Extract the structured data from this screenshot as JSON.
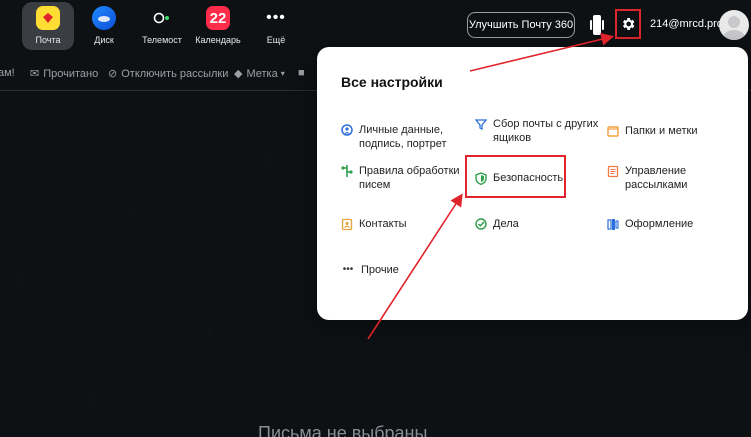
{
  "apps": [
    {
      "id": "mail",
      "label": "Почта",
      "icon": "mail-icon",
      "active": true
    },
    {
      "id": "disk",
      "label": "Диск",
      "icon": "disk-icon"
    },
    {
      "id": "telemost",
      "label": "Телемост",
      "icon": "telemost-icon"
    },
    {
      "id": "calendar",
      "label": "Календарь",
      "icon": "calendar-icon",
      "badge": "22"
    },
    {
      "id": "more",
      "label": "Ещё",
      "icon": "more-icon"
    }
  ],
  "header": {
    "upgrade_label": "Улучшить Почту 360",
    "email": "214@mrcd.pro"
  },
  "toolbar": {
    "spam_label": "ам!",
    "read_label": "Прочитано",
    "unsubscribe_label": "Отключить рассылки",
    "tag_label": "Метка"
  },
  "main": {
    "empty_label": "Письма не выбраны"
  },
  "settings": {
    "title": "Все настройки",
    "items": [
      {
        "label": "Личные данные,\nподпись, портрет",
        "icon": "person-icon"
      },
      {
        "label": "Сбор почты с других\nящиков",
        "icon": "funnel-icon"
      },
      {
        "label": "Папки и метки",
        "icon": "folder-icon"
      },
      {
        "label": "Правила обработки\nписем",
        "icon": "rules-icon"
      },
      {
        "label": "Безопасность",
        "icon": "shield-icon"
      },
      {
        "label": "Управление\nрассылками",
        "icon": "newsletter-icon"
      },
      {
        "label": "Контакты",
        "icon": "contacts-icon"
      },
      {
        "label": "Дела",
        "icon": "check-icon"
      },
      {
        "label": "Оформление",
        "icon": "theme-icon"
      },
      {
        "label": "Прочие",
        "icon": "dots-icon"
      }
    ]
  },
  "colors": {
    "accent_red": "#e0242b",
    "mail_yellow": "#ffdd33",
    "calendar_red": "#ff2d4a",
    "background": "#0e1114"
  }
}
